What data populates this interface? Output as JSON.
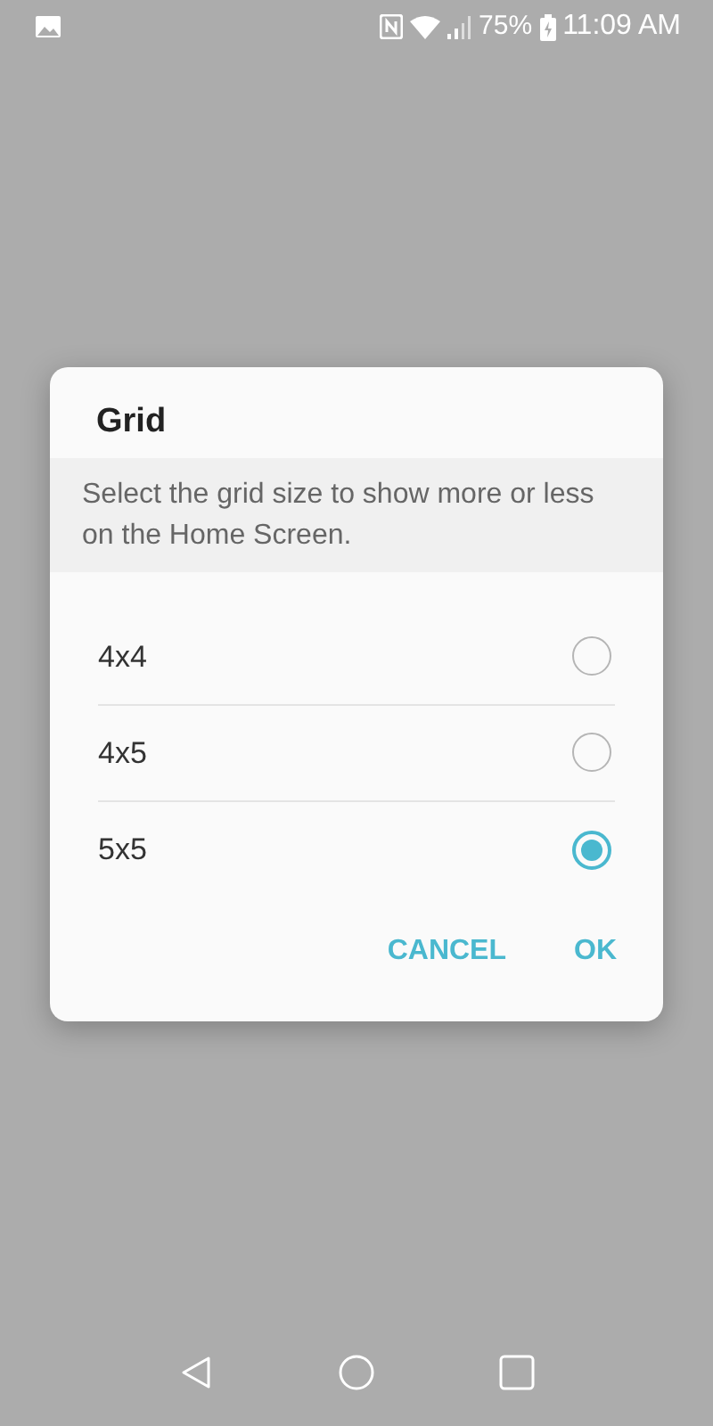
{
  "status_bar": {
    "battery_text": "75%",
    "time": "11:09 AM"
  },
  "dialog": {
    "title": "Grid",
    "description": "Select the grid size to show more or less on the Home Screen.",
    "options": [
      {
        "label": "4x4",
        "selected": false
      },
      {
        "label": "4x5",
        "selected": false
      },
      {
        "label": "5x5",
        "selected": true
      }
    ],
    "buttons": [
      "CANCEL",
      "OK"
    ]
  }
}
